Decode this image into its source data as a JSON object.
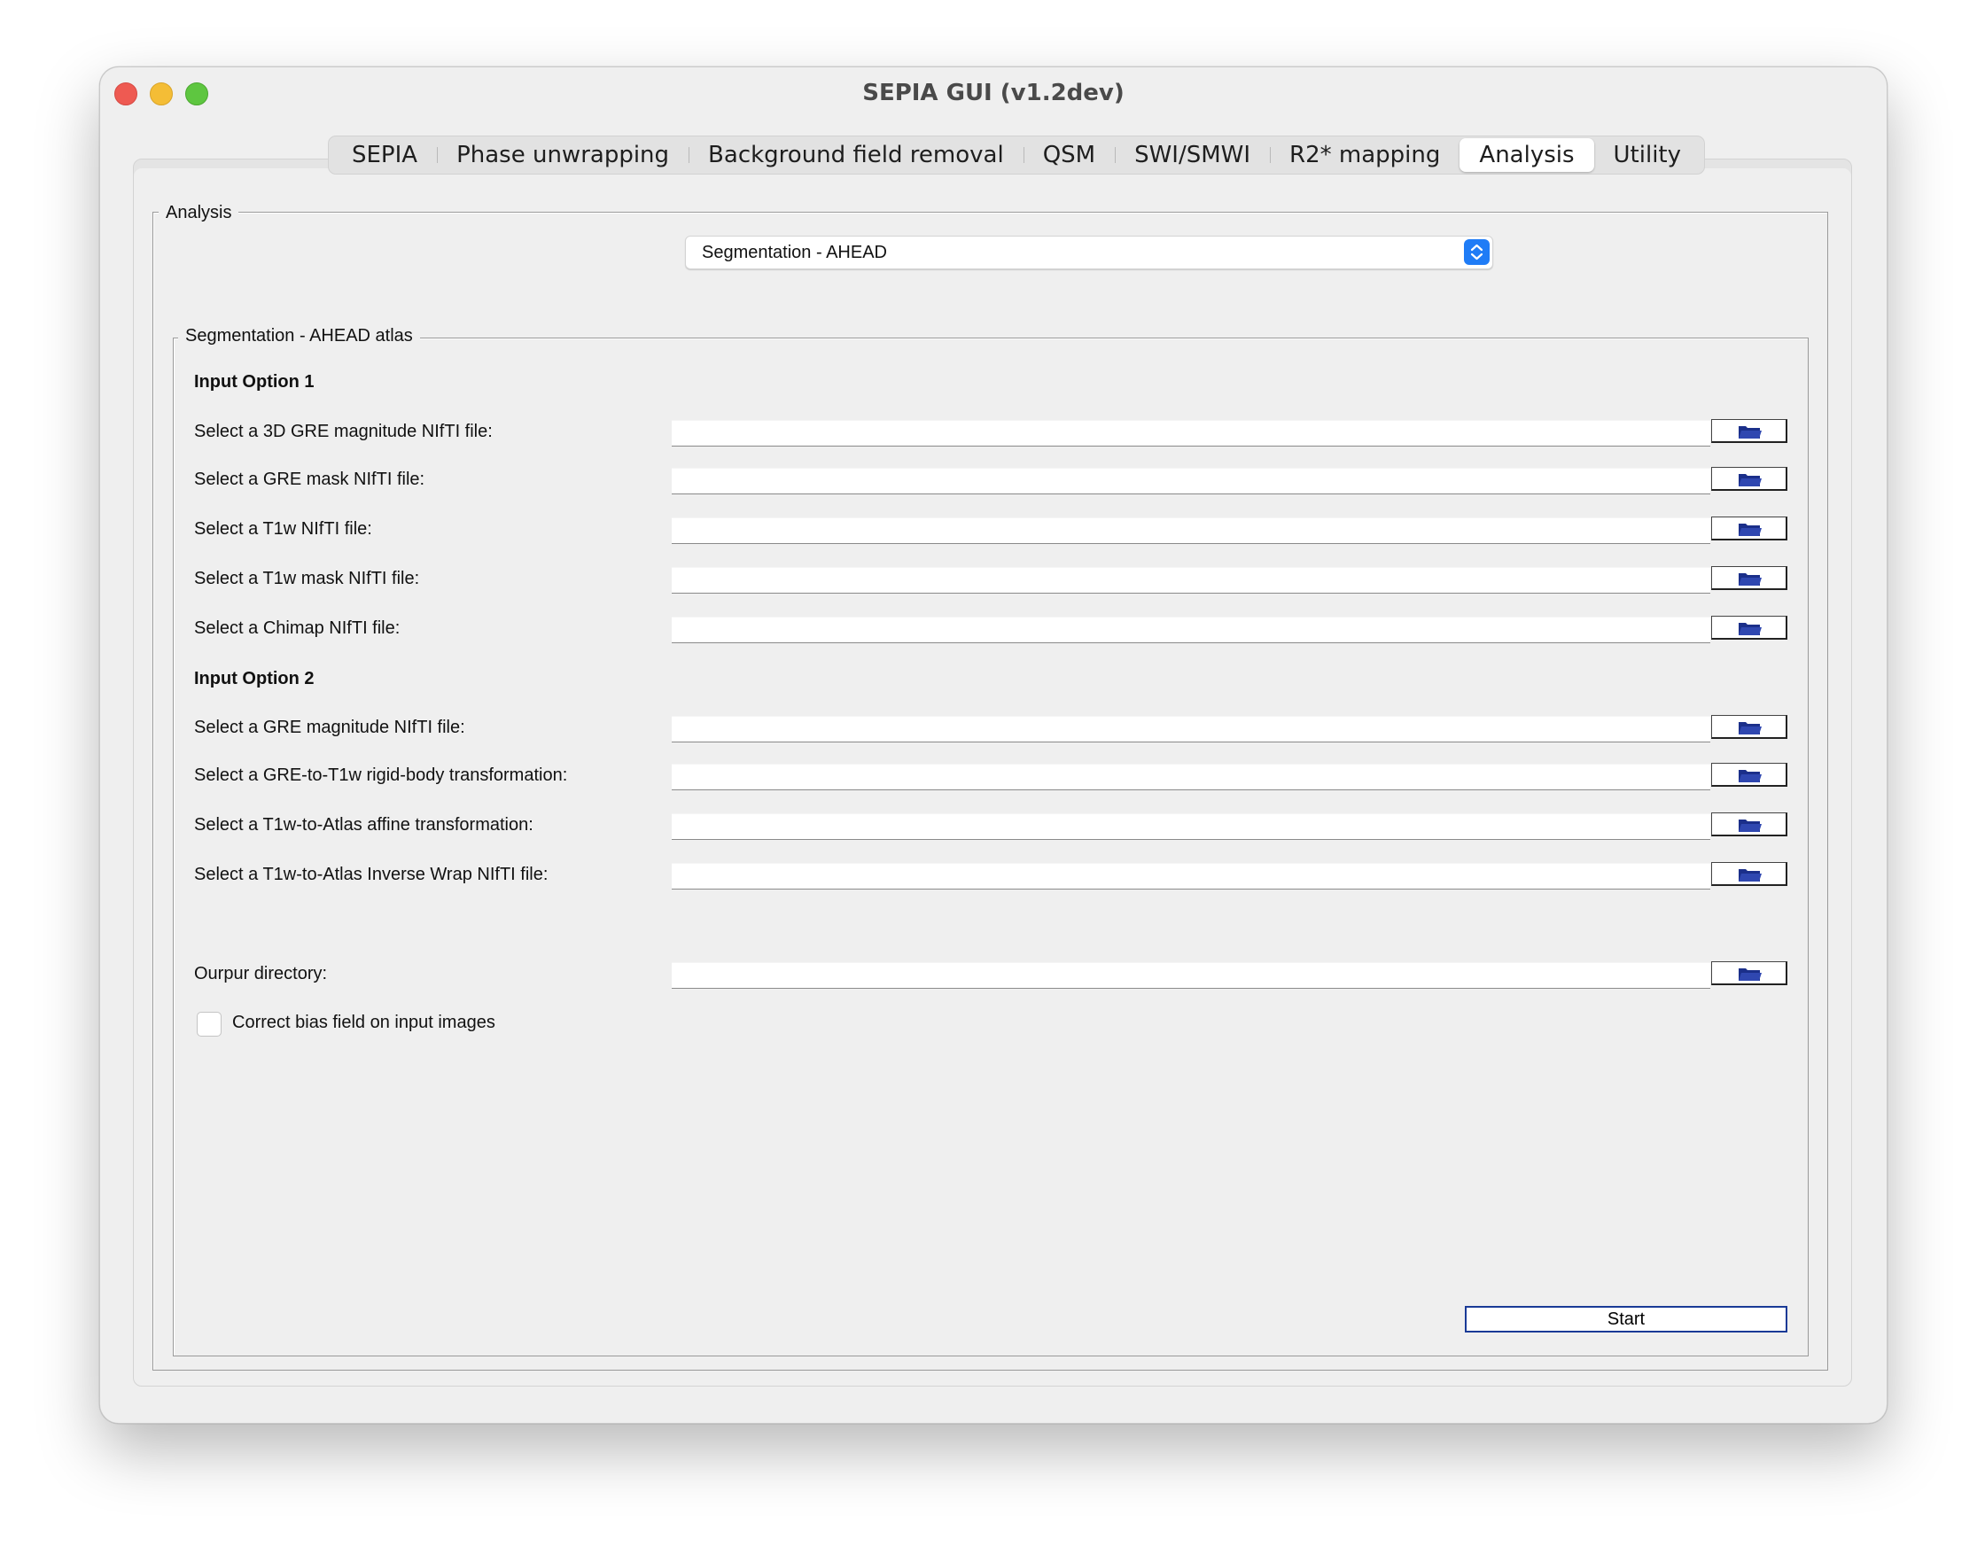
{
  "window": {
    "title": "SEPIA GUI (v1.2dev)"
  },
  "tabs": [
    {
      "label": "SEPIA"
    },
    {
      "label": "Phase unwrapping"
    },
    {
      "label": "Background field removal"
    },
    {
      "label": "QSM"
    },
    {
      "label": "SWI/SMWI"
    },
    {
      "label": "R2* mapping"
    },
    {
      "label": "Analysis",
      "active": true
    },
    {
      "label": "Utility"
    }
  ],
  "analysis": {
    "group_label": "Analysis",
    "method_selected": "Segmentation - AHEAD"
  },
  "segmentation": {
    "group_label": "Segmentation - AHEAD atlas",
    "option1_heading": "Input Option 1",
    "option2_heading": "Input Option 2",
    "rows": [
      {
        "label": "Select a 3D GRE magnitude NIfTI file:",
        "value": ""
      },
      {
        "label": "Select a GRE mask NIfTI file:",
        "value": ""
      },
      {
        "label": "Select a T1w NIfTI file:",
        "value": ""
      },
      {
        "label": "Select a T1w mask NIfTI file:",
        "value": ""
      },
      {
        "label": "Select a Chimap NIfTI file:",
        "value": ""
      },
      {
        "label": "Select a GRE magnitude NIfTI file:",
        "value": ""
      },
      {
        "label": "Select a GRE-to-T1w rigid-body transformation:",
        "value": ""
      },
      {
        "label": "Select a T1w-to-Atlas affine transformation:",
        "value": ""
      },
      {
        "label": "Select a T1w-to-Atlas Inverse Wrap NIfTI file:",
        "value": ""
      },
      {
        "label": "Ourpur directory:",
        "value": ""
      }
    ],
    "bias_checkbox_label": "Correct bias field on input images",
    "bias_checkbox_checked": false,
    "start_label": "Start"
  },
  "colors": {
    "accent": "#1f7cf6",
    "browse_icon": "#1b2f8a"
  },
  "icons": {
    "browse": "folder-icon",
    "dropdown": "chevron-updown-icon"
  }
}
